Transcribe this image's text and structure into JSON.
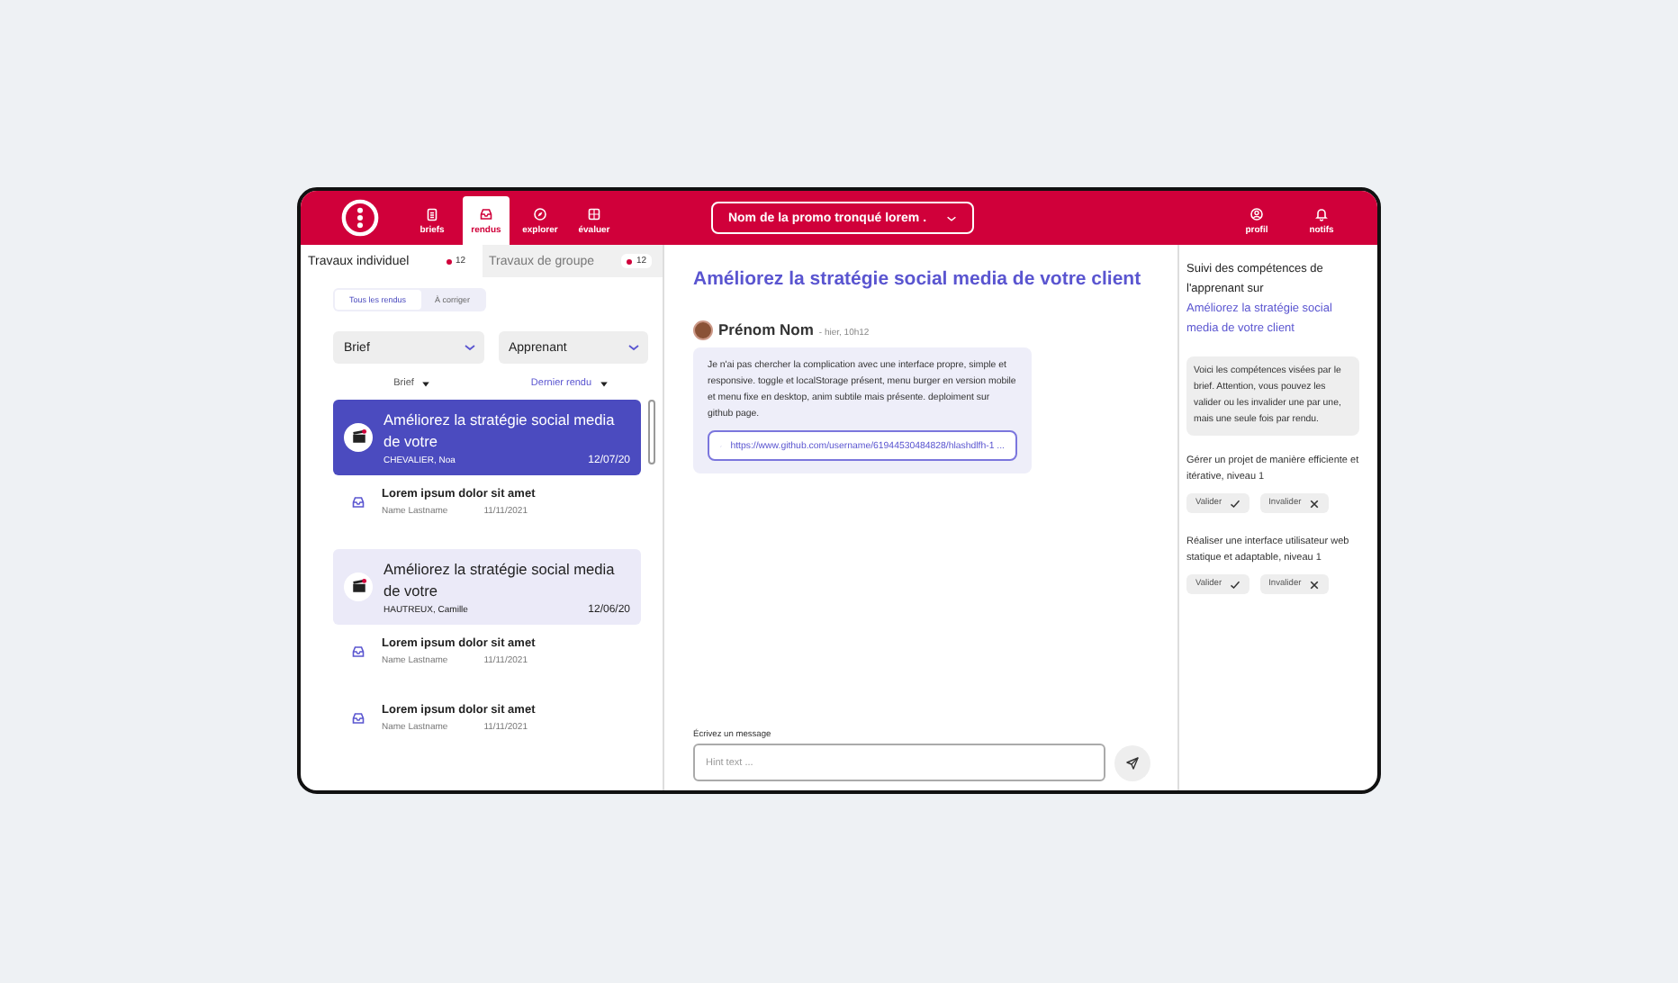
{
  "header": {
    "nav": [
      {
        "label": "briefs",
        "selected": false
      },
      {
        "label": "rendus",
        "selected": true
      },
      {
        "label": "explorer",
        "selected": false
      },
      {
        "label": "évaluer",
        "selected": false
      }
    ],
    "promo_select": "Nom de la promo tronqué lorem .",
    "actions": [
      {
        "label": "profil"
      },
      {
        "label": "notifs"
      }
    ]
  },
  "left": {
    "tabs": [
      {
        "label": "Travaux individuel",
        "count": "12",
        "selected": true
      },
      {
        "label": "Travaux de groupe",
        "count": "12",
        "selected": false
      }
    ],
    "filter_toggle": [
      {
        "label": "Tous les rendus",
        "selected": true
      },
      {
        "label": "À corriger",
        "selected": false
      }
    ],
    "dropdowns": [
      "Brief",
      "Apprenant"
    ],
    "sort": [
      {
        "label": "Brief",
        "selected": false
      },
      {
        "label": "Dernier rendu",
        "selected": true
      }
    ],
    "items": [
      {
        "kind": "featured",
        "title": "Améliorez la stratégie social media de votre",
        "name": "CHEVALIER, Noa",
        "date": "12/07/20",
        "selected": true
      },
      {
        "kind": "compact",
        "title": "Lorem ipsum dolor sit amet",
        "name": "Name Lastname",
        "date": "11/11/2021",
        "selected": false
      },
      {
        "kind": "featured",
        "title": "Améliorez la stratégie social media de votre",
        "name": "HAUTREUX, Camille",
        "date": "12/06/20",
        "selected": false
      },
      {
        "kind": "compact",
        "title": "Lorem ipsum dolor sit amet",
        "name": "Name Lastname",
        "date": "11/11/2021",
        "selected": false
      },
      {
        "kind": "compact",
        "title": "Lorem ipsum dolor sit amet",
        "name": "Name Lastname",
        "date": "11/11/2021",
        "selected": false
      }
    ]
  },
  "center": {
    "title": "Améliorez la stratégie social media de votre client",
    "message": {
      "author": "Prénom Nom",
      "time": "- hier, 10h12",
      "text": "Je n'ai pas chercher la complication avec une interface propre, simple et responsive. toggle et localStorage présent, menu burger en version mobile et menu fixe en desktop, anim subtile mais présente. deploiment sur github page.",
      "link": "https://www.github.com/username/61944530484828/hlashdlfh-1 ..."
    },
    "composer": {
      "label": "Écrivez un message",
      "placeholder": "Hint text ..."
    }
  },
  "right": {
    "intro": "Suivi des compétences de l'apprenant sur",
    "intro_link": "Améliorez la stratégie social media de votre client",
    "note": "Voici les compétences visées par le brief. Attention, vous pouvez les valider ou les invalider une par une, mais une seule fois par rendu.",
    "skills": [
      {
        "text": "Gérer un projet de manière efficiente et itérative, niveau 1",
        "validate": "Valider",
        "invalidate": "Invalider"
      },
      {
        "text": "Réaliser une interface utilisateur web statique et adaptable, niveau 1",
        "validate": "Valider",
        "invalidate": "Invalider"
      }
    ]
  }
}
